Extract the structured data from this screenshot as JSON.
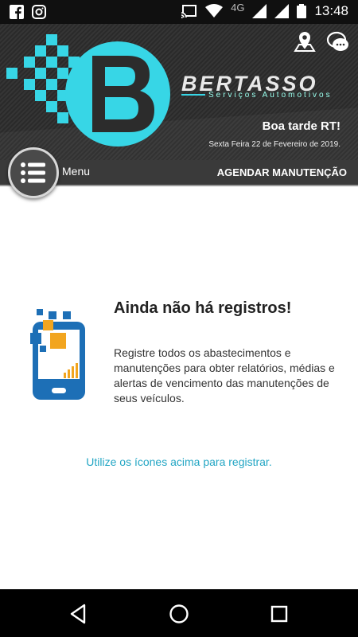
{
  "status_bar": {
    "time": "13:48",
    "network": "4G",
    "icons": [
      "facebook-icon",
      "instagram-icon",
      "cast-icon",
      "wifi-icon",
      "signal-icon",
      "battery-icon"
    ]
  },
  "header": {
    "brand_name": "BERTASSO",
    "brand_tagline": "Serviços Automotivos",
    "greeting": "Boa tarde RT!",
    "date": "Sexta Feira 22 de Fevereiro de 2019.",
    "icons": [
      "map-pin-icon",
      "chat-icon"
    ]
  },
  "menubar": {
    "menu_label": "Menu",
    "schedule_label": "AGENDAR MANUTENÇÃO"
  },
  "empty_state": {
    "title": "Ainda não há registros!",
    "text": "Registre todos os abastecimentos e manutenções para obter relatórios, médias e alertas de vencimento das manutenções de seus veículos.",
    "hint": "Utilize os ícones acima para registrar."
  },
  "colors": {
    "accent": "#23a6c4",
    "logo_cyan": "#37d6e6",
    "header_bg": "#2f2f2f",
    "menubar_bg": "#3a3a3a"
  }
}
